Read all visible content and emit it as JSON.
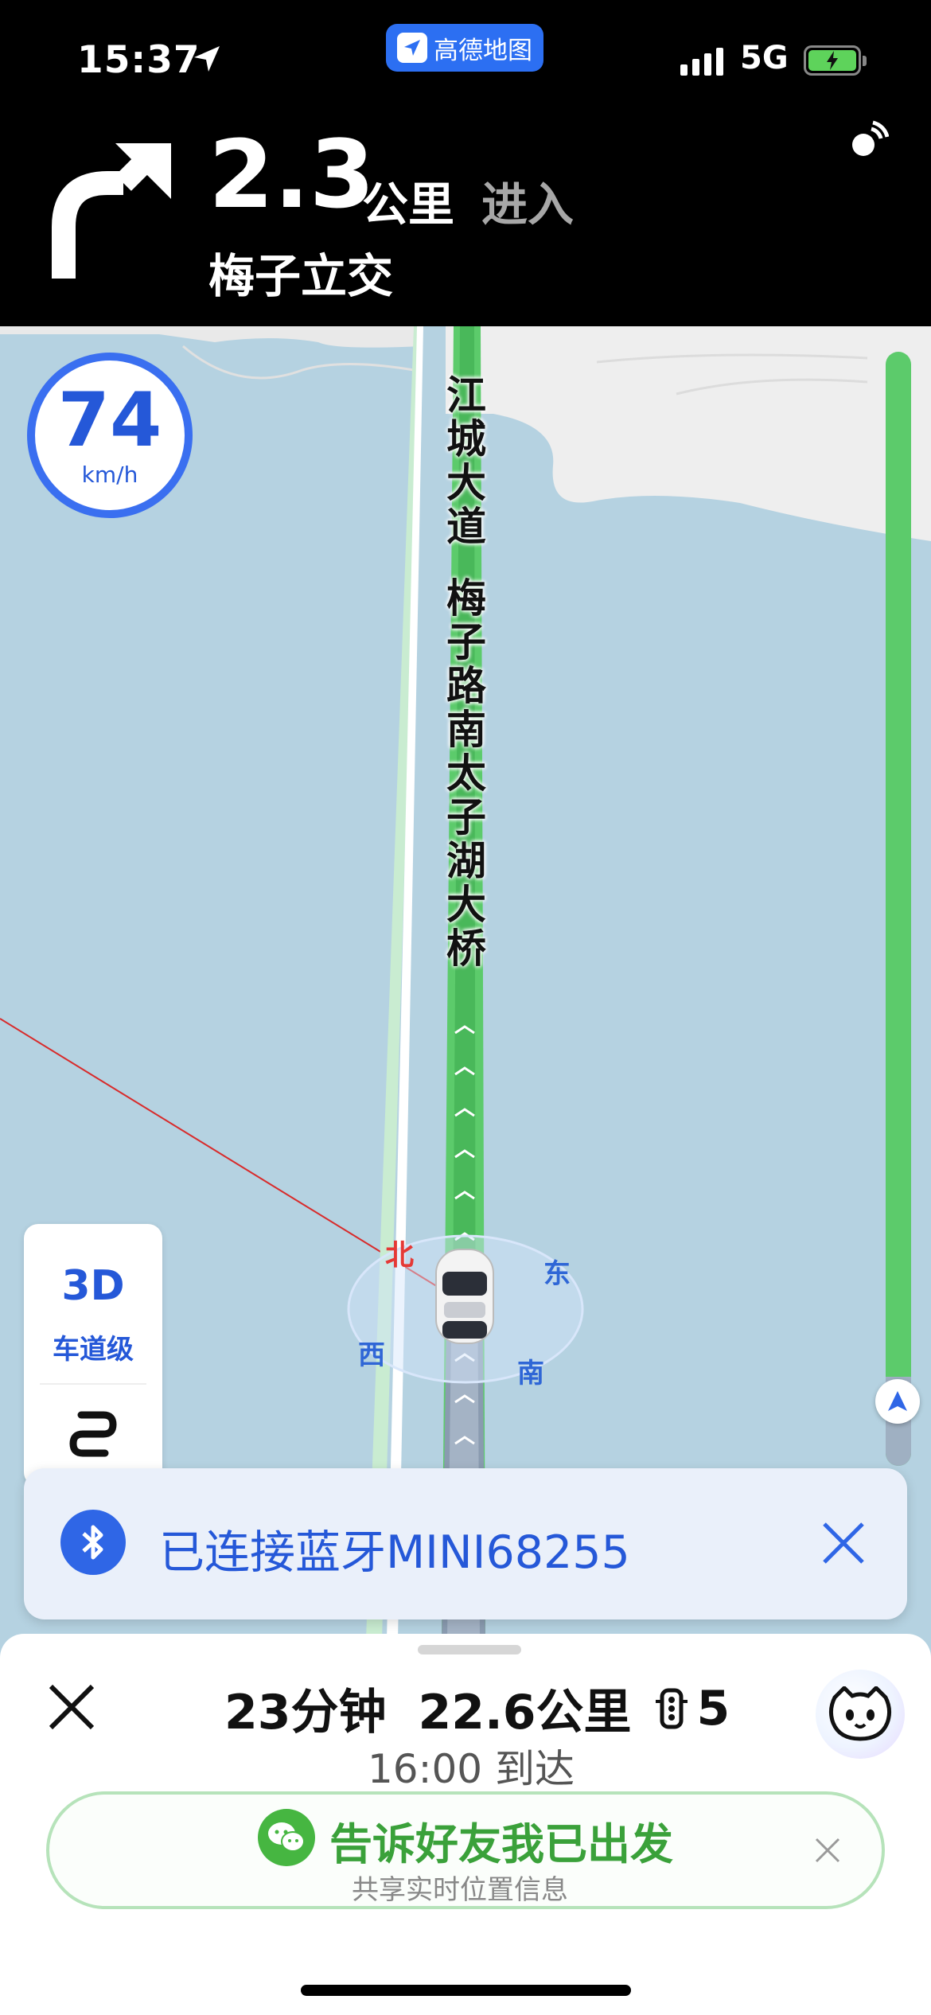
{
  "status_bar": {
    "time": "15:37",
    "app_badge": "高德地图",
    "network": "5G"
  },
  "guidance": {
    "distance_value": "2.3",
    "distance_unit": "公里",
    "action": "进入",
    "road_name": "梅子立交",
    "turn_icon": "turn-right-arrow-icon"
  },
  "map": {
    "speed_value": "74",
    "speed_unit": "km/h",
    "road_label_1": [
      "江",
      "城",
      "大",
      "道"
    ],
    "road_label_2": [
      "梅",
      "子",
      "路",
      "南",
      "太",
      "子",
      "湖",
      "大",
      "桥"
    ],
    "compass": {
      "north": "北",
      "east": "东",
      "west": "西",
      "south": "南"
    },
    "view_mode": "3D",
    "lane_level": "车道级",
    "route_progress_fraction": 0.92
  },
  "bluetooth_toast": {
    "text": "已连接蓝牙MINI68255"
  },
  "bottom_sheet": {
    "time_remaining": "23分钟",
    "distance_remaining": "22.6公里",
    "traffic_lights": "5",
    "arrival": "16:00 到达",
    "share_title": "告诉好友我已出发",
    "share_subtitle": "共享实时位置信息"
  },
  "colors": {
    "accent_blue": "#2558d8",
    "route_green": "#5ccb6b",
    "share_green": "#3aa13a",
    "water": "#b5d2e1"
  }
}
